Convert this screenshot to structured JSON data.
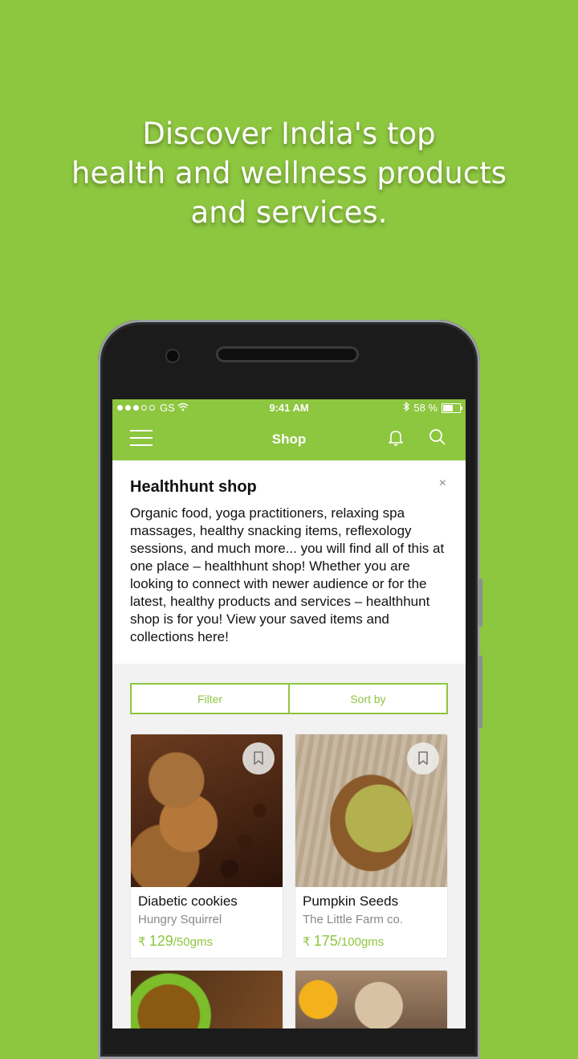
{
  "colors": {
    "accent": "#8dc63f"
  },
  "headline": {
    "lines": [
      "Discover India's top",
      "health and wellness products",
      "and services."
    ]
  },
  "statusbar": {
    "carrier": "GS",
    "time": "9:41 AM",
    "battery": "58 %",
    "battery_level": 0.58
  },
  "appbar": {
    "title": "Shop",
    "menu_icon": "hamburger-icon",
    "bell_icon": "bell-icon",
    "search_icon": "search-icon"
  },
  "info_card": {
    "title": "Healthhunt shop",
    "body": "Organic food, yoga practitioners, relaxing spa massages, healthy snacking items, reflexology sessions, and much more... you will find all of this at one place – healthhunt shop! Whether you are looking to connect with newer audience or for the latest, healthy products and services – healthhunt shop is for you! View your saved items and collections here!",
    "close": "×"
  },
  "controls": {
    "filter": "Filter",
    "sort": "Sort by"
  },
  "products": [
    {
      "name": "Diabetic cookies",
      "brand": "Hungry Squirrel",
      "currency": "₹",
      "price": "129",
      "unit": "/50gms"
    },
    {
      "name": "Pumpkin Seeds",
      "brand": "The Little Farm co.",
      "currency": "₹",
      "price": "175",
      "unit": "/100gms"
    }
  ]
}
